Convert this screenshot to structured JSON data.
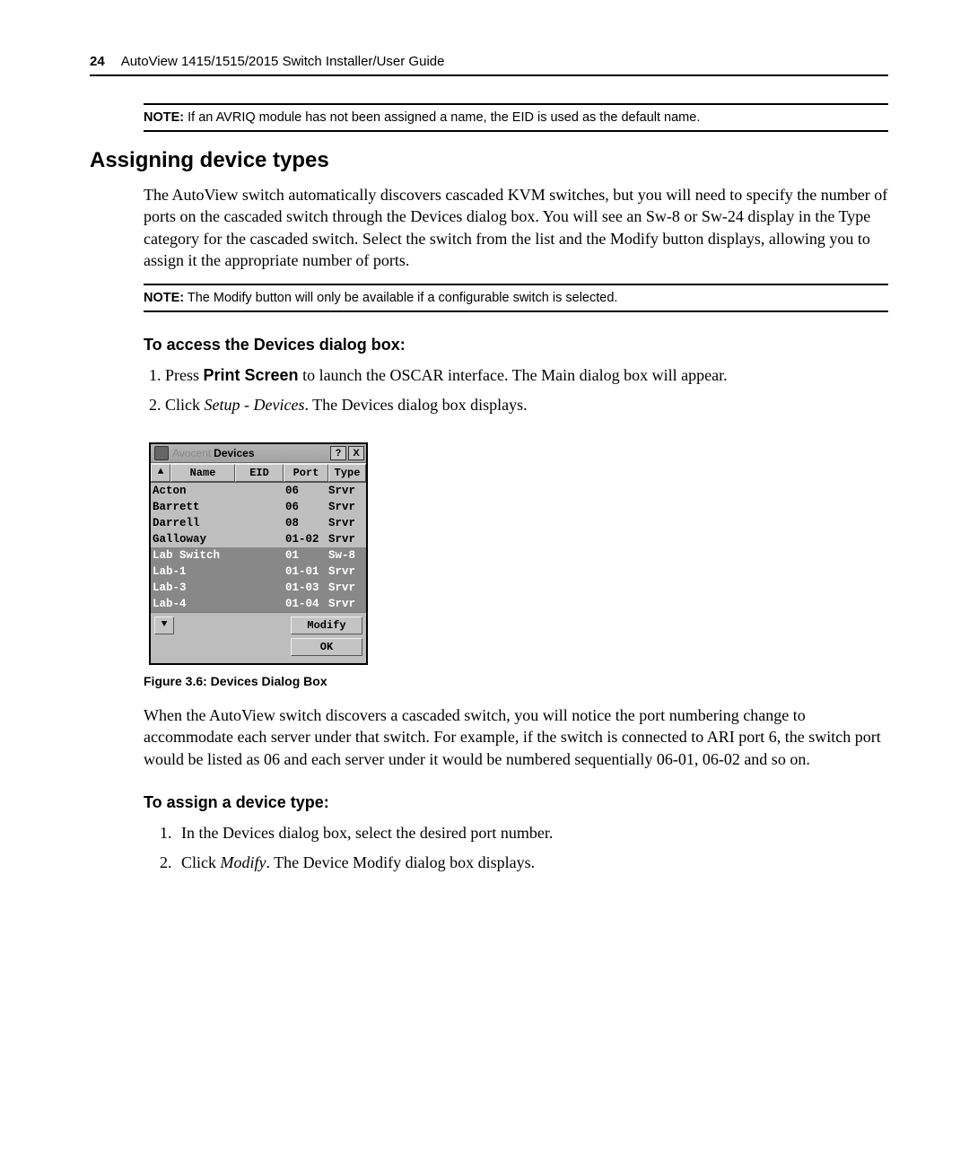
{
  "header": {
    "page_number": "24",
    "doc_title": "AutoView 1415/1515/2015 Switch Installer/User Guide"
  },
  "note1": {
    "label": "NOTE:",
    "text": " If an AVRIQ module has not been assigned a name, the EID is used as the default name."
  },
  "section_heading": "Assigning device types",
  "intro_para": "The AutoView switch automatically discovers cascaded KVM switches, but you will need to specify the number of ports on the cascaded switch through the Devices dialog box. You will see an Sw-8 or Sw-24 display in the Type category for the cascaded switch. Select the switch from the list and the Modify button displays, allowing you to assign it the appropriate number of ports.",
  "note2": {
    "label": "NOTE:",
    "text": " The Modify button will only be available if a configurable switch is selected."
  },
  "sub1": "To access the Devices dialog box:",
  "steps1": {
    "s1a": "Press ",
    "s1b": "Print Screen",
    "s1c": " to launch the OSCAR interface. The Main dialog box will appear.",
    "s2a": "Click ",
    "s2b": "Setup - Devices",
    "s2c": ". The Devices dialog box displays."
  },
  "dialog": {
    "brand": "Avocent",
    "title": "Devices",
    "help": "?",
    "close": "X",
    "sort_up": "▲",
    "sort_dn": "▼",
    "col_name": "Name",
    "col_eid": "EID",
    "col_port": "Port",
    "col_type": "Type",
    "rows": [
      {
        "name": "Acton",
        "port": "06",
        "type": "Srvr",
        "sel": false
      },
      {
        "name": "Barrett",
        "port": "06",
        "type": "Srvr",
        "sel": false
      },
      {
        "name": "Darrell",
        "port": "08",
        "type": "Srvr",
        "sel": false
      },
      {
        "name": "Galloway",
        "port": "01-02",
        "type": "Srvr",
        "sel": false
      },
      {
        "name": "Lab Switch",
        "port": "01",
        "type": "Sw-8",
        "sel": true
      },
      {
        "name": "Lab-1",
        "port": "01-01",
        "type": "Srvr",
        "sel": true
      },
      {
        "name": "Lab-3",
        "port": "01-03",
        "type": "Srvr",
        "sel": true
      },
      {
        "name": "Lab-4",
        "port": "01-04",
        "type": "Srvr",
        "sel": true
      }
    ],
    "modify": "Modify",
    "ok": "OK"
  },
  "figure_caption": "Figure 3.6: Devices Dialog Box",
  "para2": "When the AutoView switch discovers a cascaded switch, you will notice the port numbering change to accommodate each server under that switch. For example, if the switch is connected to ARI port 6, the switch port would be listed as 06 and each server under it would be numbered sequentially 06-01, 06-02 and so on.",
  "sub2": "To assign a device type:",
  "steps2": {
    "s1": "In the Devices dialog box, select the desired port number.",
    "s2a": "Click ",
    "s2b": "Modify",
    "s2c": ". The Device Modify dialog box displays."
  }
}
